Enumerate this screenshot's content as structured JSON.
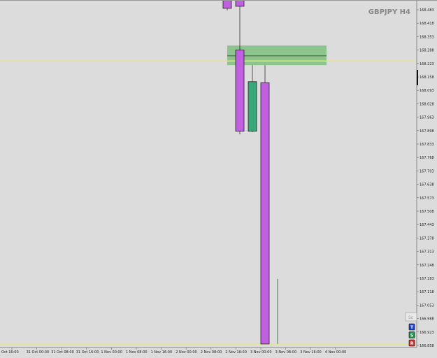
{
  "chart_data": {
    "type": "candlestick",
    "title": "GBPJPY H4",
    "y_axis_side": "right",
    "y_ticks": [
      "168.483",
      "168.418",
      "168.353",
      "168.288",
      "168.223",
      "168.158",
      "168.093",
      "168.028",
      "167.963",
      "167.898",
      "167.833",
      "167.768",
      "167.703",
      "167.638",
      "167.573",
      "167.508",
      "167.443",
      "167.378",
      "167.313",
      "167.248",
      "167.183",
      "167.118",
      "167.053",
      "166.988",
      "166.923",
      "166.858"
    ],
    "x_ticks": [
      "Oct 16:00",
      "31 Oct 00:00",
      "31 Oct 08:00",
      "31 Oct 16:00",
      "1 Nov 00:00",
      "1 Nov 08:00",
      "1 Nov 16:00",
      "2 Nov 00:00",
      "2 Nov 08:00",
      "2 Nov 16:00",
      "3 Nov 00:00",
      "3 Nov 08:00",
      "3 Nov 16:00",
      "4 Nov 00:00"
    ],
    "candles": [
      {
        "bar": 2.0,
        "open": 168.531,
        "high": 168.56,
        "low": 168.48,
        "close": 168.49,
        "color": "#c060e0"
      },
      {
        "bar": 2.5,
        "open": 168.54,
        "high": 168.56,
        "low": 168.28,
        "close": 168.5,
        "color": "#c060e0"
      },
      {
        "bar": 3.0,
        "open": 168.288,
        "high": 168.3,
        "low": 167.88,
        "close": 167.895,
        "color": "#c060e0"
      },
      {
        "bar": 3.5,
        "open": 167.895,
        "high": 168.215,
        "low": 167.89,
        "close": 168.135,
        "color": "#3aa77a"
      },
      {
        "bar": 4.0,
        "open": 168.13,
        "high": 168.215,
        "low": 166.865,
        "close": 166.865,
        "color": "#c060e0"
      },
      {
        "bar": 5.0,
        "open": 167.18,
        "high": 167.18,
        "low": 166.865,
        "close": 166.865,
        "color": "#4a7a4a",
        "wick_only": true
      }
    ],
    "zone": {
      "top": 168.31,
      "bottom": 168.215,
      "start_bar": 2.5,
      "end_bar": 6.0,
      "line": 168.26,
      "color": "#7fc07f"
    },
    "horizontal_lines": [
      {
        "value": 168.235,
        "color": "#e8e870"
      },
      {
        "value": 166.865,
        "color": "#e8e870"
      }
    ],
    "buttons": [
      {
        "label": "T",
        "color": "#2040d0"
      },
      {
        "label": "S",
        "color": "#209050"
      },
      {
        "label": "R",
        "color": "#d03030"
      }
    ],
    "scroll_label": "Sc"
  }
}
